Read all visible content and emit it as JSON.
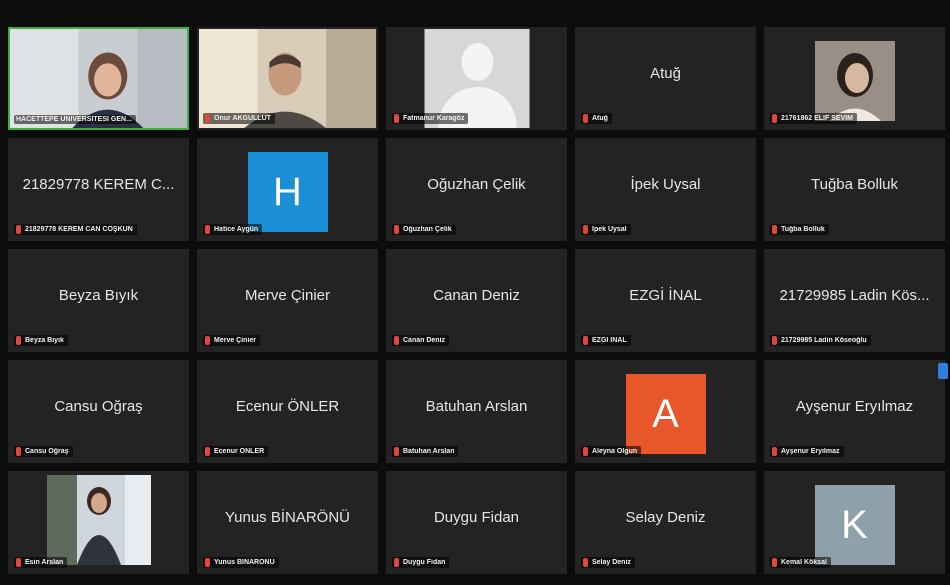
{
  "colors": {
    "tile_bg": "#232323",
    "active_border": "#3fae3f",
    "mic_muted": "#e0463c",
    "avatar_H": "#1b8fd6",
    "avatar_A": "#e8572a",
    "avatar_K": "#8ea1aa"
  },
  "participants": [
    {
      "label": "HACETTEPE ÜNİVERSİTESİ GEN...",
      "center": ""
    },
    {
      "label": "Onur AKGÜLLÜT",
      "center": ""
    },
    {
      "label": "Fatmanur Karagöz",
      "center": ""
    },
    {
      "label": "Atuğ",
      "center": "Atuğ"
    },
    {
      "label": "21761862 ELİF SEVİM",
      "center": ""
    },
    {
      "label": "21829778 KEREM CAN COŞKUN",
      "center": "21829778 KEREM C..."
    },
    {
      "label": "Hatice Aygün",
      "center": "",
      "avatar": "H"
    },
    {
      "label": "Oğuzhan Çelik",
      "center": "Oğuzhan Çelik"
    },
    {
      "label": "İpek Uysal",
      "center": "İpek Uysal"
    },
    {
      "label": "Tuğba Bolluk",
      "center": "Tuğba Bolluk"
    },
    {
      "label": "Beyza Bıyık",
      "center": "Beyza Bıyık"
    },
    {
      "label": "Merve Çinier",
      "center": "Merve Çinier"
    },
    {
      "label": "Canan Deniz",
      "center": "Canan Deniz"
    },
    {
      "label": "EZGİ İNAL",
      "center": "EZGİ İNAL"
    },
    {
      "label": "21729985 Ladin Köseoğlu",
      "center": "21729985 Ladin Kös..."
    },
    {
      "label": "Cansu Oğraş",
      "center": "Cansu Oğraş"
    },
    {
      "label": "Ecenur ÖNLER",
      "center": "Ecenur ÖNLER"
    },
    {
      "label": "Batuhan Arslan",
      "center": "Batuhan Arslan"
    },
    {
      "label": "Aleyna Olgun",
      "center": "",
      "avatar": "A"
    },
    {
      "label": "Ayşenur Eryılmaz",
      "center": "Ayşenur Eryılmaz"
    },
    {
      "label": "Esin Arslan",
      "center": ""
    },
    {
      "label": "Yunus BİNARÖNÜ",
      "center": "Yunus BİNARÖNÜ"
    },
    {
      "label": "Duygu Fidan",
      "center": "Duygu Fidan"
    },
    {
      "label": "Selay Deniz",
      "center": "Selay Deniz"
    },
    {
      "label": "Kemal Köksal",
      "center": "",
      "avatar": "K"
    }
  ]
}
